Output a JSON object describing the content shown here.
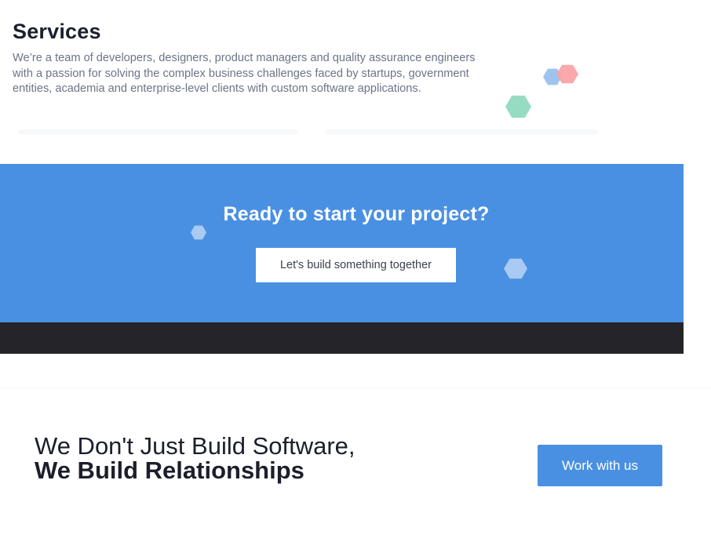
{
  "services": {
    "title": "Services",
    "description": "We’re a team of developers, designers, product managers and quality assurance engineers with a passion for solving the complex business challenges faced by startups, government entities, academia and enterprise-level clients with custom software applications."
  },
  "cta": {
    "heading": "Ready to start your project?",
    "button_label": "Let's build something together"
  },
  "tagline": {
    "line1": "We Don't Just Build Software,",
    "line2": "We Build Relationships"
  },
  "work_button_label": "Work with us",
  "colors": {
    "accent": "#4a90e2",
    "dark_band": "#242429",
    "hex_blue": "#9fc3ef",
    "hex_pink": "#f9a3a6",
    "hex_green": "#96dcc3",
    "hex_light": "#a9cbf3"
  }
}
